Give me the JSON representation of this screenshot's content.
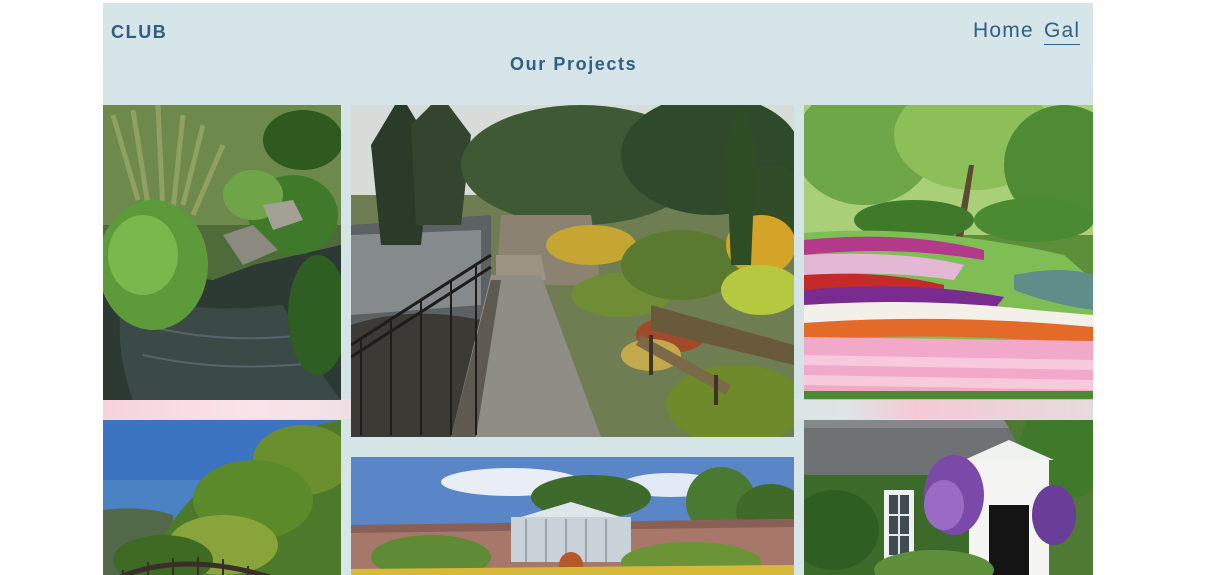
{
  "header": {
    "brand": "CLUB",
    "page_title": "Our Projects",
    "nav": {
      "home_label": "Home",
      "gallery_label": "Gal"
    }
  },
  "gallery": {
    "photos": [
      {
        "name": "stream-garden-photo"
      },
      {
        "name": "rock-garden-path-photo"
      },
      {
        "name": "tulip-beds-photo"
      },
      {
        "name": "wooded-hillside-arch-photo"
      },
      {
        "name": "walled-garden-glasshouse-photo"
      },
      {
        "name": "cottage-with-clematis-photo"
      }
    ]
  },
  "colors": {
    "header_background": "#d6e5e8",
    "text_accent": "#2f5f84"
  }
}
